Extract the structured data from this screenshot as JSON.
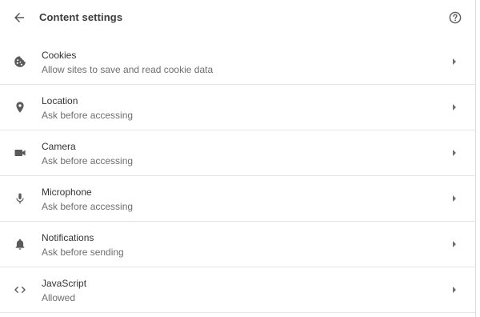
{
  "header": {
    "title": "Content settings",
    "back_icon": "arrow-back-icon",
    "help_icon": "help-icon"
  },
  "items": [
    {
      "label": "Cookies",
      "sublabel": "Allow sites to save and read cookie data",
      "icon": "cookie-icon"
    },
    {
      "label": "Location",
      "sublabel": "Ask before accessing",
      "icon": "location-pin-icon"
    },
    {
      "label": "Camera",
      "sublabel": "Ask before accessing",
      "icon": "camera-icon"
    },
    {
      "label": "Microphone",
      "sublabel": "Ask before accessing",
      "icon": "microphone-icon"
    },
    {
      "label": "Notifications",
      "sublabel": "Ask before sending",
      "icon": "bell-icon"
    },
    {
      "label": "JavaScript",
      "sublabel": "Allowed",
      "icon": "code-icon"
    }
  ],
  "colors": {
    "icon": "#5a5a5a",
    "divider": "#e6e6e6",
    "text_primary": "#333333",
    "text_secondary": "#6e6e6e"
  }
}
